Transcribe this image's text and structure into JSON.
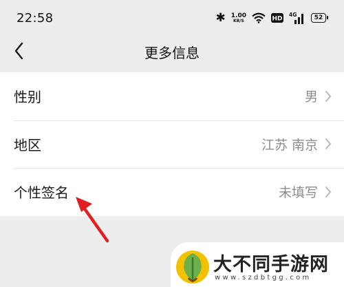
{
  "status_bar": {
    "time": "22:58",
    "net_speed_value": "1.00",
    "net_speed_unit": "KB/S",
    "hd_badge": "HD",
    "network": "4G",
    "battery": "52",
    "icons": [
      "bluetooth-icon",
      "wifi-icon",
      "hd-icon",
      "signal-icon",
      "battery-icon"
    ]
  },
  "header": {
    "back_icon": "chevron-left-icon",
    "title": "更多信息"
  },
  "rows": [
    {
      "label": "性别",
      "value": "男"
    },
    {
      "label": "地区",
      "value": "江苏 南京"
    },
    {
      "label": "个性签名",
      "value": "未填写"
    }
  ],
  "annotation": {
    "color": "#e02020",
    "icon": "red-arrow"
  },
  "watermark": {
    "name": "大不同手游网",
    "url": "www.szdbtgg.com"
  },
  "colors": {
    "background": "#ededed",
    "card": "#ffffff",
    "secondary_text": "#8c8c8c"
  }
}
